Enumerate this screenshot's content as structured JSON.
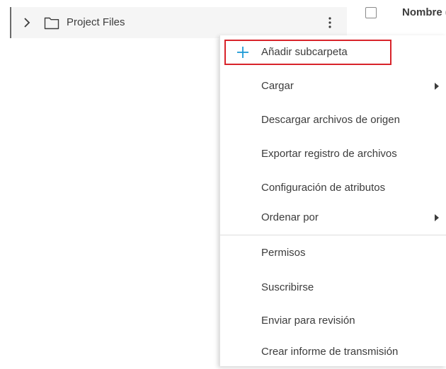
{
  "tree": {
    "folder_label": "Project Files",
    "chevron_icon": "chevron-right-icon",
    "folder_icon": "folder-icon",
    "more_icon": "kebab-icon"
  },
  "table_header": {
    "column_label": "Nombre ("
  },
  "menu": {
    "items": [
      {
        "label": "Añadir subcarpeta",
        "icon": "plus-icon",
        "highlighted": true
      },
      {
        "label": "Cargar",
        "submenu": true
      },
      {
        "label": "Descargar archivos de origen"
      },
      {
        "label": "Exportar registro de archivos"
      },
      {
        "label": "Configuración de atributos"
      },
      {
        "label": "Ordenar por",
        "submenu": true
      },
      {
        "label": "Permisos"
      },
      {
        "label": "Suscribirse"
      },
      {
        "label": "Enviar para revisión"
      },
      {
        "label": "Crear informe de transmisión"
      }
    ]
  },
  "colors": {
    "accent": "#1e9ad6",
    "highlight": "#d8232a",
    "row_background": "#f5f5f5"
  }
}
